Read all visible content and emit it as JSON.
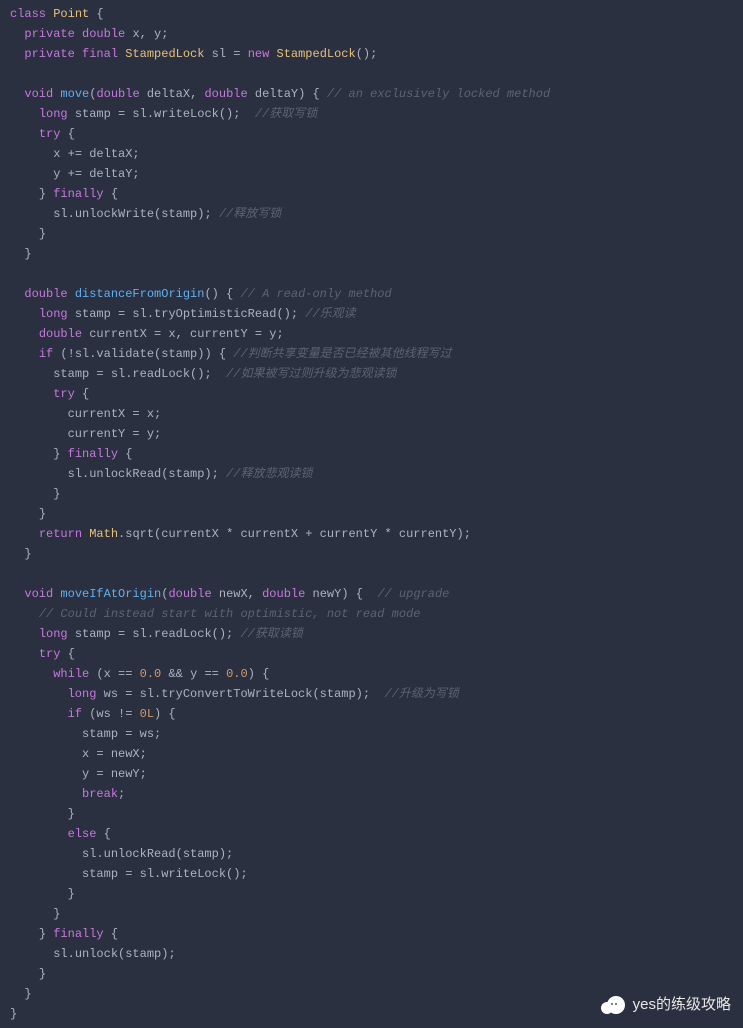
{
  "code": {
    "l01": {
      "kw_class": "class",
      "type": "Point",
      "brace": " {"
    },
    "l02": {
      "kw_priv": "private",
      "kw_dbl": "double",
      "vars": " x, y;"
    },
    "l03": {
      "kw_priv": "private",
      "kw_final": "final",
      "type": "StampedLock",
      "var": " sl ",
      "eq": "= ",
      "kw_new": "new",
      "ctor": " StampedLock",
      "tail": "();"
    },
    "l05": {
      "kw_void": "void",
      "fn": "move",
      "open": "(",
      "kw_d1": "double",
      "p1": " deltaX, ",
      "kw_d2": "double",
      "p2": " deltaY) { ",
      "cmt": "// an exclusively locked method"
    },
    "l06": {
      "kw_long": "long",
      "txt": " stamp = sl.writeLock();  ",
      "cmt": "//获取写锁"
    },
    "l07": {
      "kw_try": "try",
      "brace": " {"
    },
    "l08": {
      "txt": "x += deltaX;"
    },
    "l09": {
      "txt": "y += deltaY;"
    },
    "l10": {
      "close": "} ",
      "kw_fin": "finally",
      "brace": " {"
    },
    "l11": {
      "txt": "sl.unlockWrite(stamp); ",
      "cmt": "//释放写锁"
    },
    "l12": {
      "txt": "}"
    },
    "l13": {
      "txt": "}"
    },
    "l15": {
      "kw_dbl": "double",
      "fn": " distanceFromOrigin",
      "paren": "() { ",
      "cmt": "// A read-only method"
    },
    "l16": {
      "kw_long": "long",
      "txt": " stamp = sl.tryOptimisticRead(); ",
      "cmt": "//乐观读"
    },
    "l17": {
      "kw_dbl": "double",
      "txt": " currentX = x, currentY = y;"
    },
    "l18": {
      "kw_if": "if",
      "txt": " (!sl.validate(stamp)) { ",
      "cmt": "//判断共享变量是否已经被其他线程写过"
    },
    "l19": {
      "txt": "stamp = sl.readLock();  ",
      "cmt": "//如果被写过则升级为悲观读锁"
    },
    "l20": {
      "kw_try": "try",
      "brace": " {"
    },
    "l21": {
      "txt": "currentX = x;"
    },
    "l22": {
      "txt": "currentY = y;"
    },
    "l23": {
      "close": "} ",
      "kw_fin": "finally",
      "brace": " {"
    },
    "l24": {
      "txt": "sl.unlockRead(stamp); ",
      "cmt": "//释放悲观读锁"
    },
    "l25": {
      "txt": "}"
    },
    "l26": {
      "txt": "}"
    },
    "l27": {
      "kw_ret": "return",
      "type": " Math",
      "txt": ".sqrt(currentX * currentX + currentY * currentY);"
    },
    "l28": {
      "txt": "}"
    },
    "l30": {
      "kw_void": "void",
      "fn": " moveIfAtOrigin",
      "open": "(",
      "kw_d1": "double",
      "p1": " newX, ",
      "kw_d2": "double",
      "p2": " newY) {  ",
      "cmt": "// upgrade"
    },
    "l31": {
      "cmt": "// Could instead start with optimistic, not read mode"
    },
    "l32": {
      "kw_long": "long",
      "txt": " stamp = sl.readLock(); ",
      "cmt": "//获取读锁"
    },
    "l33": {
      "kw_try": "try",
      "brace": " {"
    },
    "l34": {
      "kw_while": "while",
      "txt1": " (x == ",
      "num1": "0.0",
      "txt2": " && y == ",
      "num2": "0.0",
      "txt3": ") {"
    },
    "l35": {
      "kw_long": "long",
      "txt": " ws = sl.tryConvertToWriteLock(stamp);  ",
      "cmt": "//升级为写锁"
    },
    "l36": {
      "kw_if": "if",
      "txt1": " (ws != ",
      "num": "0L",
      "txt2": ") {"
    },
    "l37": {
      "txt": "stamp = ws;"
    },
    "l38": {
      "txt": "x = newX;"
    },
    "l39": {
      "txt": "y = newY;"
    },
    "l40": {
      "kw_break": "break",
      "semi": ";"
    },
    "l41": {
      "txt": "}"
    },
    "l42": {
      "kw_else": "else",
      "brace": " {"
    },
    "l43": {
      "txt": "sl.unlockRead(stamp);"
    },
    "l44": {
      "txt": "stamp = sl.writeLock();"
    },
    "l45": {
      "txt": "}"
    },
    "l46": {
      "txt": "}"
    },
    "l47": {
      "close": "} ",
      "kw_fin": "finally",
      "brace": " {"
    },
    "l48": {
      "txt": "sl.unlock(stamp);"
    },
    "l49": {
      "txt": "}"
    },
    "l50": {
      "txt": "}"
    },
    "l51": {
      "txt": "}"
    }
  },
  "watermark": "yes的练级攻略"
}
